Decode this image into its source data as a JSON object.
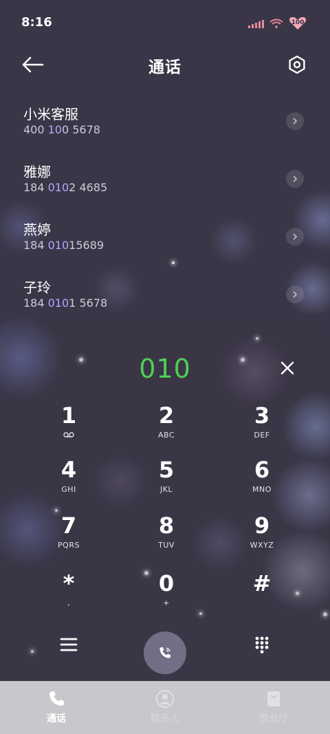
{
  "status_bar": {
    "time": "8:16",
    "battery": "100"
  },
  "header": {
    "title": "通话"
  },
  "contacts": [
    {
      "name": "小米客服",
      "num_pre": "400 ",
      "num_hl": "10",
      "num_post": "0 5678"
    },
    {
      "name": "雅娜",
      "num_pre": "184 ",
      "num_hl": "010",
      "num_post": "2 4685"
    },
    {
      "name": "燕婷",
      "num_pre": "184 ",
      "num_hl": "010",
      "num_post": "15689"
    },
    {
      "name": "子玲",
      "num_pre": "184 ",
      "num_hl": "010",
      "num_post": "1 5678"
    }
  ],
  "dialer": {
    "input": "010",
    "keys": [
      {
        "digit": "1",
        "letters": ""
      },
      {
        "digit": "2",
        "letters": "ABC"
      },
      {
        "digit": "3",
        "letters": "DEF"
      },
      {
        "digit": "4",
        "letters": "GHI"
      },
      {
        "digit": "5",
        "letters": "JKL"
      },
      {
        "digit": "6",
        "letters": "MNO"
      },
      {
        "digit": "7",
        "letters": "PQRS"
      },
      {
        "digit": "8",
        "letters": "TUV"
      },
      {
        "digit": "9",
        "letters": "WXYZ"
      },
      {
        "digit": "*",
        "letters": ","
      },
      {
        "digit": "0",
        "letters": "+"
      },
      {
        "digit": "#",
        "letters": ""
      }
    ]
  },
  "tabs": [
    {
      "label": "通话",
      "icon": "phone-icon"
    },
    {
      "label": "联系人",
      "icon": "person-icon"
    },
    {
      "label": "营业厅",
      "icon": "shop-icon"
    }
  ],
  "colors": {
    "accent_green": "#4fcf56",
    "highlight": "#b6a6ff",
    "background": "#3a3647"
  }
}
